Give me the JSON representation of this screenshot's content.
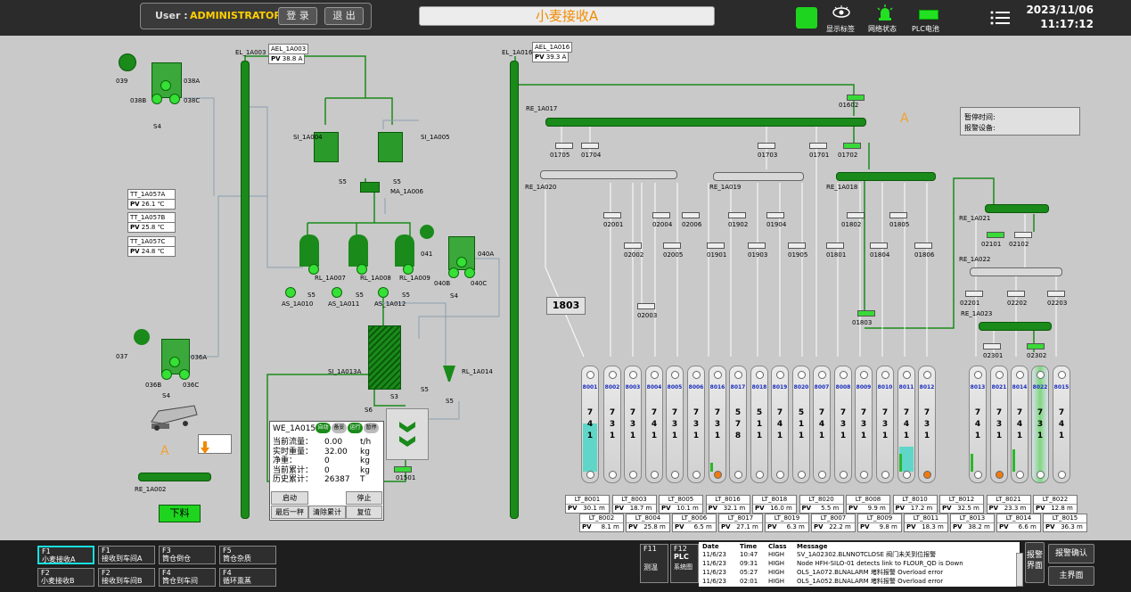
{
  "header": {
    "user_label": "User :",
    "user_name": "ADMINISTRATOR",
    "login_btn": "登 录",
    "logout_btn": "退 出",
    "title": "小麦接收A",
    "icon_labels": [
      "显示标签",
      "网络状态",
      "PLC电池"
    ],
    "date": "2023/11/06",
    "time": "11:17:12"
  },
  "left_plant": {
    "el": "EL_1A003",
    "ael": "AEL_1A003",
    "ael_pv": "38.8",
    "ael_unit": "A",
    "fan_039": "039",
    "f038a": "038A",
    "f038b": "038B",
    "f038c": "038C",
    "s4a": "S4",
    "si1": "SI_1A004",
    "si2": "SI_1A005",
    "s5a": "S5",
    "s5b": "S5",
    "ma": "MA_1A006",
    "tt": [
      {
        "name": "TT_1A057A",
        "pv": "26.1",
        "unit": "℃"
      },
      {
        "name": "TT_1A057B",
        "pv": "25.8",
        "unit": "℃"
      },
      {
        "name": "TT_1A057C",
        "pv": "24.8",
        "unit": "℃"
      }
    ],
    "rl1": "RL_1A007",
    "rl2": "RL_1A008",
    "rl3": "RL_1A009",
    "as1": "AS_1A010",
    "as2": "AS_1A011",
    "as3": "AS_1A012",
    "s5c": "S5",
    "s5d": "S5",
    "s5e": "S5",
    "fan_041": "041",
    "f040a": "040A",
    "f040b": "040B",
    "f040c": "040C",
    "s4b": "S4",
    "fan_037": "037",
    "f036a": "036A",
    "f036b": "036B",
    "f036c": "036C",
    "s4c": "S4",
    "si13": "SI_1A013A",
    "s3": "S3",
    "s5f": "S5",
    "s6": "S6",
    "s5g": "S5",
    "rl14": "RL_1A014",
    "s5h": "S5",
    "re1a002": "RE_1A002",
    "marker_a": "A",
    "xialiao": "下料",
    "g01501": "01501",
    "tag_1803": "1803"
  },
  "scale": {
    "name": "WE_1A015",
    "states": [
      "自动",
      "备妥",
      "运行",
      "暂停"
    ],
    "rows": [
      {
        "label": "当前流量：",
        "value": "0.00",
        "unit": "t/h"
      },
      {
        "label": "实时重量：",
        "value": "32.00",
        "unit": "kg"
      },
      {
        "label": "净重：",
        "value": "0",
        "unit": "kg"
      },
      {
        "label": "当前累计：",
        "value": "0",
        "unit": "kg"
      },
      {
        "label": "历史累计：",
        "value": "26387",
        "unit": "T"
      }
    ],
    "btn_start": "启动",
    "btn_stop": "停止",
    "btn_last": "最后一秤",
    "btn_clear": "清除累计",
    "btn_reset": "复位"
  },
  "right_plant": {
    "el": "EL_1A016",
    "ael": "AEL_1A016",
    "ael_pv": "39.3",
    "ael_unit": "A",
    "re17": "RE_1A017",
    "re20": "RE_1A020",
    "re19": "RE_1A019",
    "re18": "RE_1A018",
    "re21": "RE_1A021",
    "re22": "RE_1A022",
    "re23": "RE_1A023",
    "marker_a": "A",
    "pause_time": "暂停时间:",
    "pause_dev": "报警设备:",
    "gates": [
      "01602",
      "01705",
      "01704",
      "01703",
      "01701",
      "01702",
      "02001",
      "02004",
      "02006",
      "01902",
      "01904",
      "01802",
      "01805",
      "02002",
      "02005",
      "01901",
      "01903",
      "01905",
      "01801",
      "01804",
      "01806",
      "02003",
      "01803",
      "02101",
      "02102",
      "02201",
      "02202",
      "02203",
      "02301",
      "02302"
    ]
  },
  "silos_left": [
    {
      "id": "8001",
      "lv": [
        "7",
        "4",
        "1"
      ]
    },
    {
      "id": "8002",
      "lv": [
        "7",
        "3",
        "1"
      ]
    },
    {
      "id": "8003",
      "lv": [
        "7",
        "3",
        "1"
      ]
    },
    {
      "id": "8004",
      "lv": [
        "7",
        "4",
        "1"
      ]
    },
    {
      "id": "8005",
      "lv": [
        "7",
        "3",
        "1"
      ]
    },
    {
      "id": "8006",
      "lv": [
        "7",
        "3",
        "1"
      ]
    },
    {
      "id": "8016",
      "lv": [
        "7",
        "3",
        "1"
      ]
    },
    {
      "id": "8017",
      "lv": [
        "5",
        "7",
        "8"
      ]
    },
    {
      "id": "8018",
      "lv": [
        "5",
        "1",
        "1"
      ]
    },
    {
      "id": "8019",
      "lv": [
        "7",
        "4",
        "1"
      ]
    },
    {
      "id": "8020",
      "lv": [
        "5",
        "1",
        "1"
      ]
    },
    {
      "id": "8007",
      "lv": [
        "7",
        "4",
        "1"
      ]
    },
    {
      "id": "8008",
      "lv": [
        "7",
        "3",
        "1"
      ]
    },
    {
      "id": "8009",
      "lv": [
        "7",
        "3",
        "1"
      ]
    },
    {
      "id": "8010",
      "lv": [
        "7",
        "3",
        "1"
      ]
    },
    {
      "id": "8011",
      "lv": [
        "7",
        "4",
        "1"
      ]
    },
    {
      "id": "8012",
      "lv": [
        "7",
        "3",
        "1"
      ]
    }
  ],
  "silos_right": [
    {
      "id": "8013",
      "lv": [
        "7",
        "4",
        "1"
      ]
    },
    {
      "id": "8021",
      "lv": [
        "7",
        "3",
        "1"
      ]
    },
    {
      "id": "8014",
      "lv": [
        "7",
        "4",
        "1"
      ]
    },
    {
      "id": "8022",
      "lv": [
        "7",
        "3",
        "1"
      ]
    },
    {
      "id": "8015",
      "lv": [
        "7",
        "4",
        "1"
      ]
    }
  ],
  "lt_row1": [
    {
      "name": "LT_8001",
      "pv": "30.1",
      "u": "m"
    },
    {
      "name": "LT_8003",
      "pv": "18.7",
      "u": "m"
    },
    {
      "name": "LT_8005",
      "pv": "10.1",
      "u": "m"
    },
    {
      "name": "LT_8016",
      "pv": "32.1",
      "u": "m"
    },
    {
      "name": "LT_8018",
      "pv": "16.0",
      "u": "m"
    },
    {
      "name": "LT_8020",
      "pv": "5.5",
      "u": "m"
    },
    {
      "name": "LT_8008",
      "pv": "9.9",
      "u": "m"
    },
    {
      "name": "LT_8010",
      "pv": "17.2",
      "u": "m"
    },
    {
      "name": "LT_8012",
      "pv": "32.5",
      "u": "m"
    },
    {
      "name": "LT_8021",
      "pv": "23.3",
      "u": "m"
    },
    {
      "name": "LT_8022",
      "pv": "12.8",
      "u": "m"
    }
  ],
  "lt_row2": [
    {
      "name": "LT_8002",
      "pv": "8.1",
      "u": "m"
    },
    {
      "name": "LT_8004",
      "pv": "25.8",
      "u": "m"
    },
    {
      "name": "LT_8006",
      "pv": "6.5",
      "u": "m"
    },
    {
      "name": "LT_8017",
      "pv": "27.1",
      "u": "m"
    },
    {
      "name": "LT_8019",
      "pv": "6.3",
      "u": "m"
    },
    {
      "name": "LT_8007",
      "pv": "22.2",
      "u": "m"
    },
    {
      "name": "LT_8009",
      "pv": "9.8",
      "u": "m"
    },
    {
      "name": "LT_8011",
      "pv": "18.3",
      "u": "m"
    },
    {
      "name": "LT_8013",
      "pv": "38.2",
      "u": "m"
    },
    {
      "name": "LT_8014",
      "pv": "6.6",
      "u": "m"
    },
    {
      "name": "LT_8015",
      "pv": "36.3",
      "u": "m"
    }
  ],
  "footer": {
    "fkeys": [
      {
        "k": "F1",
        "l": "小麦接收A"
      },
      {
        "k": "F1",
        "l": "接收到车间A"
      },
      {
        "k": "F3",
        "l": "筒仓倒仓"
      },
      {
        "k": "F5",
        "l": "筒仓杂质"
      },
      {
        "k": "F2",
        "l": "小麦接收B"
      },
      {
        "k": "F2",
        "l": "接收到车间B"
      },
      {
        "k": "F4",
        "l": "筒仓到车间"
      },
      {
        "k": "F4",
        "l": "循环熏蒸"
      }
    ],
    "f11": "F11",
    "f11_label": "测温",
    "f12": "F12",
    "f12_plc": "PLC",
    "f12_label": "系统图",
    "alarm_headers": [
      "Date",
      "Time",
      "Class",
      "Message"
    ],
    "alarms": [
      {
        "d": "11/6/23",
        "t": "10:47",
        "c": "HIGH",
        "m": "SV_1A02302.BLNNOTCLOSE 阀门未关到位报警"
      },
      {
        "d": "11/6/23",
        "t": "09:31",
        "c": "HIGH",
        "m": "Node HFH-SILO-01 detects link to FLOUR_QD is Down"
      },
      {
        "d": "11/6/23",
        "t": "05:27",
        "c": "HIGH",
        "m": "OLS_1A072.BLNALARM 堵料报警 Overload error"
      },
      {
        "d": "11/6/23",
        "t": "02:01",
        "c": "HIGH",
        "m": "OLS_1A052.BLNALARM 堵料报警 Overload error"
      }
    ],
    "alarm_page_btn": "报警界面",
    "ack_btn": "报警确认",
    "main_btn": "主界面"
  },
  "colors": {
    "green": "#1a8a1a",
    "bright_green": "#36e036",
    "silo_fill": "#5fd6c8",
    "title_orange": "#f28b00",
    "topbar": "#2b2b2b"
  }
}
